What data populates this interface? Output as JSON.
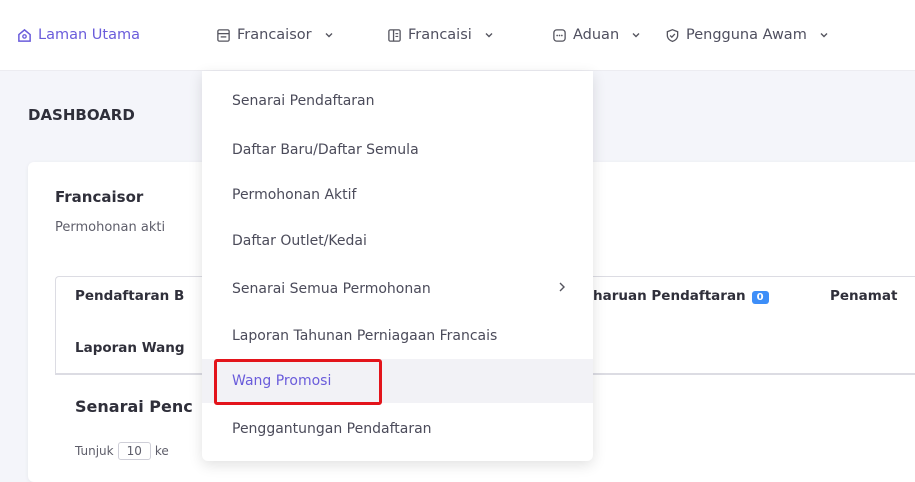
{
  "nav": {
    "items": [
      {
        "label": "Laman Utama",
        "icon": "home-icon",
        "active": true
      },
      {
        "label": "Francaisor",
        "icon": "file-text-icon"
      },
      {
        "label": "Francaisi",
        "icon": "columns-icon"
      },
      {
        "label": "Aduan",
        "icon": "message-dots-icon"
      },
      {
        "label": "Pengguna Awam",
        "icon": "shield-check-icon"
      }
    ]
  },
  "page": {
    "title": "DASHBOARD"
  },
  "card": {
    "title": "Francaisor",
    "subtitle": "Permohonan akti",
    "tabs": [
      {
        "label": "Pendaftaran B"
      },
      {
        "label": "haruan Pendaftaran",
        "badge": "0"
      },
      {
        "label": "Penamat"
      },
      {
        "label": "Laporan Wang"
      }
    ],
    "section_title": "Senarai Penc",
    "show_label": "Tunjuk",
    "show_value": "10",
    "show_suffix": "ke"
  },
  "dropdown": {
    "items": [
      {
        "label": "Senarai Pendaftaran"
      },
      {
        "label": "Daftar Baru/Daftar Semula"
      },
      {
        "label": "Permohonan Aktif"
      },
      {
        "label": "Daftar Outlet/Kedai"
      },
      {
        "label": "Senarai Semua Permohonan",
        "submenu": true
      },
      {
        "label": "Laporan Tahunan Perniagaan Francais"
      },
      {
        "label": "Wang Promosi",
        "hover": true
      },
      {
        "label": "Penggantungan Pendaftaran"
      }
    ]
  },
  "colors": {
    "accent": "#6a5cdb",
    "highlight": "#e3141b",
    "badge": "#3d8ef8"
  }
}
